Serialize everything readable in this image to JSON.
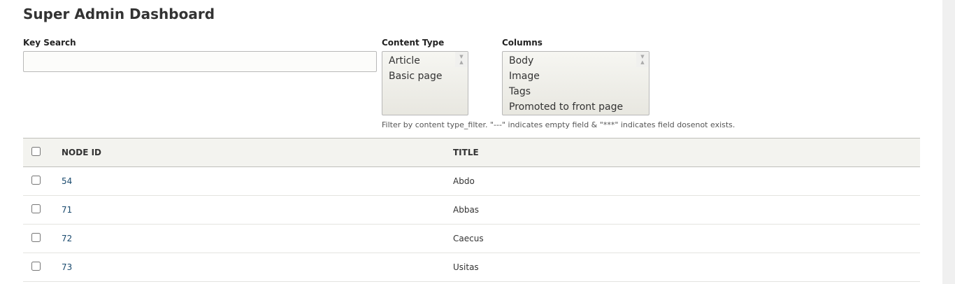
{
  "page_title": "Super Admin Dashboard",
  "key_search": {
    "label": "Key Search",
    "value": "",
    "placeholder": ""
  },
  "content_type": {
    "label": "Content Type",
    "options": [
      "Article",
      "Basic page"
    ]
  },
  "columns": {
    "label": "Columns",
    "options": [
      "Body",
      "Image",
      "Tags",
      "Promoted to front page"
    ]
  },
  "description": "Filter by content type_filter.  \"---\" indicates empty field & \"***\" indicates field dosenot exists.",
  "table": {
    "headers": [
      "NODE ID",
      "TITLE"
    ],
    "rows": [
      {
        "id": "54",
        "title": "Abdo"
      },
      {
        "id": "71",
        "title": "Abbas"
      },
      {
        "id": "72",
        "title": "Caecus"
      },
      {
        "id": "73",
        "title": "Usitas"
      }
    ]
  }
}
